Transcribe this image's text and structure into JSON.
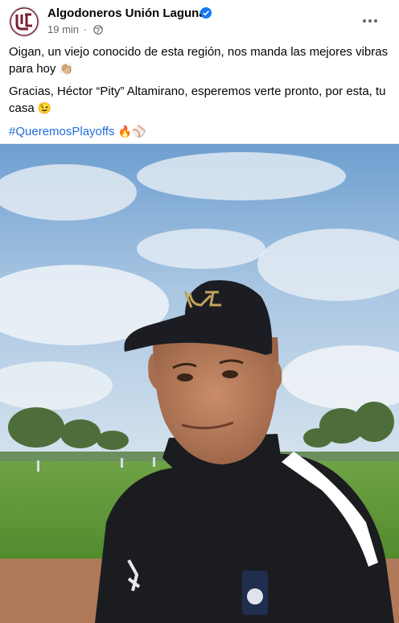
{
  "post": {
    "page_name": "Algodoneros Unión Laguna",
    "time": "19 min",
    "separator": "·",
    "paragraphs": [
      {
        "text": "Oigan, un viejo conocido de esta región, nos manda las mejores vibras para hoy",
        "emoji": "👏🏼"
      },
      {
        "text": "Gracias, Héctor “Pity” Altamirano, esperemos verte pronto, por esta, tu casa",
        "emoji": "😉"
      }
    ],
    "hashtag": "#QueremosPlayoffs",
    "hashtag_emojis": "🔥⚾"
  },
  "icons": {
    "avatar": "team-logo-icon",
    "verified": "verified-badge-icon",
    "privacy": "globe-icon",
    "more": "more-options-icon"
  },
  "colors": {
    "text": "#050505",
    "secondary": "#65676b",
    "link": "#216fdb",
    "verified": "#1877f2",
    "logo": "#7a1f35"
  }
}
